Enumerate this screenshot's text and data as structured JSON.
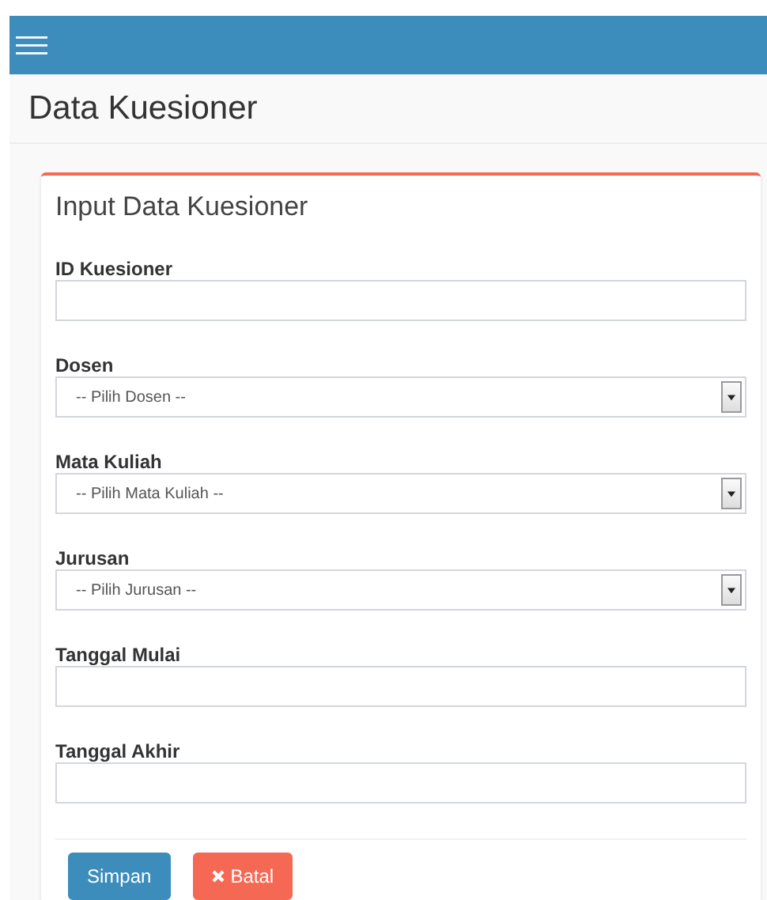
{
  "page_title": "Data Kuesioner",
  "form": {
    "title": "Input Data Kuesioner",
    "fields": [
      {
        "kind": "text",
        "label": "ID Kuesioner"
      },
      {
        "kind": "select",
        "label": "Dosen",
        "value": "-- Pilih Dosen --"
      },
      {
        "kind": "select",
        "label": "Mata Kuliah",
        "value": "-- Pilih Mata Kuliah --"
      },
      {
        "kind": "select",
        "label": "Jurusan",
        "value": "-- Pilih Jurusan --"
      },
      {
        "kind": "text",
        "label": "Tanggal Mulai"
      },
      {
        "kind": "text",
        "label": "Tanggal Akhir"
      }
    ],
    "buttons": [
      {
        "kind": "primary",
        "label": "Simpan"
      },
      {
        "kind": "cancel",
        "label": "Batal"
      }
    ]
  }
}
